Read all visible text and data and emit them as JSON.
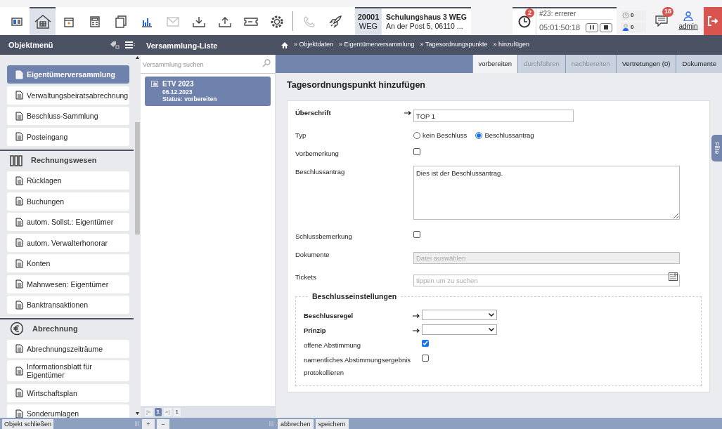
{
  "toolbar": [
    {
      "kind": "card",
      "selected": false,
      "disabled": false
    },
    {
      "kind": "house",
      "selected": true,
      "disabled": false
    },
    {
      "kind": "calendar",
      "selected": false,
      "disabled": false
    },
    {
      "kind": "calculator",
      "selected": false,
      "disabled": false
    },
    {
      "kind": "pages",
      "selected": false,
      "disabled": false
    },
    {
      "kind": "chart",
      "selected": false,
      "disabled": false
    },
    {
      "kind": "mail",
      "selected": false,
      "disabled": true
    },
    {
      "kind": "download",
      "selected": false,
      "disabled": false
    },
    {
      "kind": "upload",
      "selected": false,
      "disabled": false
    },
    {
      "kind": "ticket",
      "selected": false,
      "disabled": false
    },
    {
      "kind": "gear",
      "selected": false,
      "disabled": false
    },
    {
      "kind": "divider"
    },
    {
      "kind": "phone",
      "selected": false,
      "disabled": true
    },
    {
      "kind": "rocket",
      "selected": false,
      "disabled": false
    }
  ],
  "object": {
    "number": "20001",
    "type": "WEG",
    "name": "Schulungshaus 3 WEG",
    "address": "An der Post 5, 06110 ..."
  },
  "timer": {
    "badge": "2",
    "ticket": "#23: errerer",
    "time": "05:01:50:18"
  },
  "counters": [
    "0",
    "0"
  ],
  "messages": {
    "badge": "18"
  },
  "user": {
    "name": "admin"
  },
  "sidebar": {
    "title": "Objektmenü",
    "items": [
      {
        "kind": "item",
        "label": "Eigentümerversammlung",
        "selected": true
      },
      {
        "kind": "item",
        "label": "Verwaltungsbeiratsabrechnung",
        "selected": false
      },
      {
        "kind": "item",
        "label": "Beschluss-Sammlung",
        "selected": false
      },
      {
        "kind": "item",
        "label": "Posteingang",
        "selected": false
      },
      {
        "kind": "section",
        "label": "Rechnungswesen"
      },
      {
        "kind": "item",
        "label": "Rücklagen",
        "selected": false
      },
      {
        "kind": "item",
        "label": "Buchungen",
        "selected": false
      },
      {
        "kind": "item",
        "label": "autom. Sollst.: Eigentümer",
        "selected": false
      },
      {
        "kind": "item",
        "label": "autom. Verwalterhonorar",
        "selected": false
      },
      {
        "kind": "item",
        "label": "Konten",
        "selected": false
      },
      {
        "kind": "item",
        "label": "Mahnwesen: Eigentümer",
        "selected": false
      },
      {
        "kind": "item",
        "label": "Banktransaktionen",
        "selected": false
      },
      {
        "kind": "section",
        "label": "Abrechnung"
      },
      {
        "kind": "item",
        "label": "Abrechnungszeiträume",
        "selected": false
      },
      {
        "kind": "item",
        "label": "Informationsblatt für Eigentümer",
        "selected": false
      },
      {
        "kind": "item",
        "label": "Wirtschaftsplan",
        "selected": false
      },
      {
        "kind": "item",
        "label": "Sonderumlagen",
        "selected": false
      }
    ]
  },
  "list": {
    "title": "Versammlung-Liste",
    "search_placeholder": "Versammlung suchen",
    "items": [
      {
        "title": "ETV 2023",
        "date": "06.12.2023",
        "status": "Status: vorbereiten",
        "selected": true
      }
    ],
    "pager": {
      "first": "|«",
      "page": "1",
      "last": "»|",
      "total": "1"
    }
  },
  "breadcrumb": [
    "» Objektdaten",
    "» Eigentümerversammlung",
    "» Tagesordnungspunkte",
    "» hinzufügen"
  ],
  "tabs": [
    {
      "label": "vorbereiten",
      "selected": true,
      "disabled": false
    },
    {
      "label": "durchführen",
      "selected": false,
      "disabled": true
    },
    {
      "label": "nachbereiten",
      "selected": false,
      "disabled": true
    },
    {
      "label": "Vertretungen (0)",
      "selected": false,
      "disabled": false
    },
    {
      "label": "Dokumente",
      "selected": false,
      "disabled": false
    }
  ],
  "form": {
    "title": "Tagesordnungspunkt hinzufügen",
    "fields": [
      {
        "kind": "text",
        "label": "Überschrift",
        "required": true,
        "value": "TOP 1"
      },
      {
        "kind": "radio",
        "label": "Typ",
        "required": false,
        "options": [
          {
            "label": "kein Beschluss",
            "selected": false
          },
          {
            "label": "Beschlussantrag",
            "selected": true
          }
        ]
      },
      {
        "kind": "checkbox",
        "label": "Vorbemerkung",
        "required": false,
        "checked": false
      },
      {
        "kind": "textarea",
        "label": "Beschlussantrag",
        "required": false,
        "value": "Dies ist der Beschlussantrag."
      },
      {
        "kind": "checkbox",
        "label": "Schlussbemerkung",
        "required": false,
        "checked": false
      },
      {
        "kind": "file",
        "label": "Dokumente",
        "required": false,
        "placeholder": "Datei auswählen",
        "disabled": true
      },
      {
        "kind": "search",
        "label": "Tickets",
        "required": false,
        "placeholder": "tippen um zu suchen"
      }
    ],
    "fieldset": {
      "legend": "Beschlusseinstellungen",
      "fields": [
        {
          "kind": "select",
          "label": "Beschlussregel",
          "required": true
        },
        {
          "kind": "select",
          "label": "Prinzip",
          "required": true
        },
        {
          "kind": "checkbox",
          "label": "offene Abstimmung",
          "required": false,
          "checked": true
        },
        {
          "kind": "checkbox",
          "label": "namentliches Abstimmungsergebnis protokollieren",
          "required": false,
          "checked": false
        }
      ]
    }
  },
  "filter_tab": "Filte",
  "bottom": {
    "close": "Objekt schließen",
    "grip": "|||",
    "add": "+",
    "remove": "−",
    "cancel": "abbrechen",
    "save": "speichern"
  }
}
